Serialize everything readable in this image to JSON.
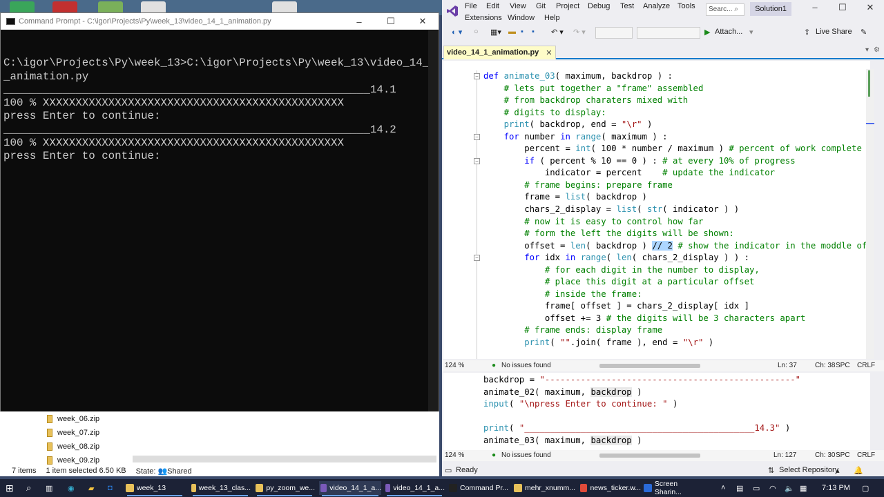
{
  "cmd": {
    "title": "Command Prompt - C:\\igor\\Projects\\Py\\week_13\\video_14_1_animation.py",
    "lines": [
      "",
      "C:\\igor\\Projects\\Py\\week_13>C:\\igor\\Projects\\Py\\week_13\\video_14_1",
      "_animation.py",
      "________________________________________________________14.1",
      "100 % XXXXXXXXXXXXXXXXXXXXXXXXXXXXXXXXXXXXXXXXXXXXXX",
      "press Enter to continue:",
      "________________________________________________________14.2",
      "100 % XXXXXXXXXXXXXXXXXXXXXXXXXXXXXXXXXXXXXXXXXXXXXX",
      "press Enter to continue:"
    ]
  },
  "explorer": {
    "files": [
      "week_06.zip",
      "week_07.zip",
      "week_08.zip",
      "week_09.zip"
    ],
    "item_count": "7 items",
    "selection": "1 item selected  6.50 KB",
    "state": "State:",
    "shared": "Shared"
  },
  "vs": {
    "menu": [
      "File",
      "Edit",
      "View",
      "Git",
      "Project",
      "Debug",
      "Test",
      "Analyze",
      "Tools"
    ],
    "menu2": [
      "Extensions",
      "Window",
      "Help"
    ],
    "search_placeholder": "Searc...",
    "solution": "Solution1",
    "attach": "Attach...",
    "live_share": "Live Share",
    "tab": "video_14_1_animation.py",
    "editor1_status": {
      "zoom": "124 %",
      "issues": "No issues found",
      "ln": "Ln: 37",
      "ch": "Ch: 38",
      "enc": "SPC",
      "eol": "CRLF"
    },
    "editor2_status": {
      "zoom": "124 %",
      "issues": "No issues found",
      "ln": "Ln: 127",
      "ch": "Ch: 30",
      "enc": "SPC",
      "eol": "CRLF"
    },
    "ready": "Ready",
    "select_repo": "Select Repository"
  },
  "taskbar": {
    "apps": [
      "week_13",
      "week_13_clas...",
      "py_zoom_we...",
      "video_14_1_a...",
      "video_14_1_a...",
      "Command Pr...",
      "mehr_xnumm...",
      "news_ticker.w...",
      "Screen Sharin..."
    ],
    "time": "7:13 PM"
  },
  "colors": {
    "vs_accent": "#007acc",
    "cmd_bg": "#0c0c0c",
    "taskbar": "#1c2236"
  }
}
